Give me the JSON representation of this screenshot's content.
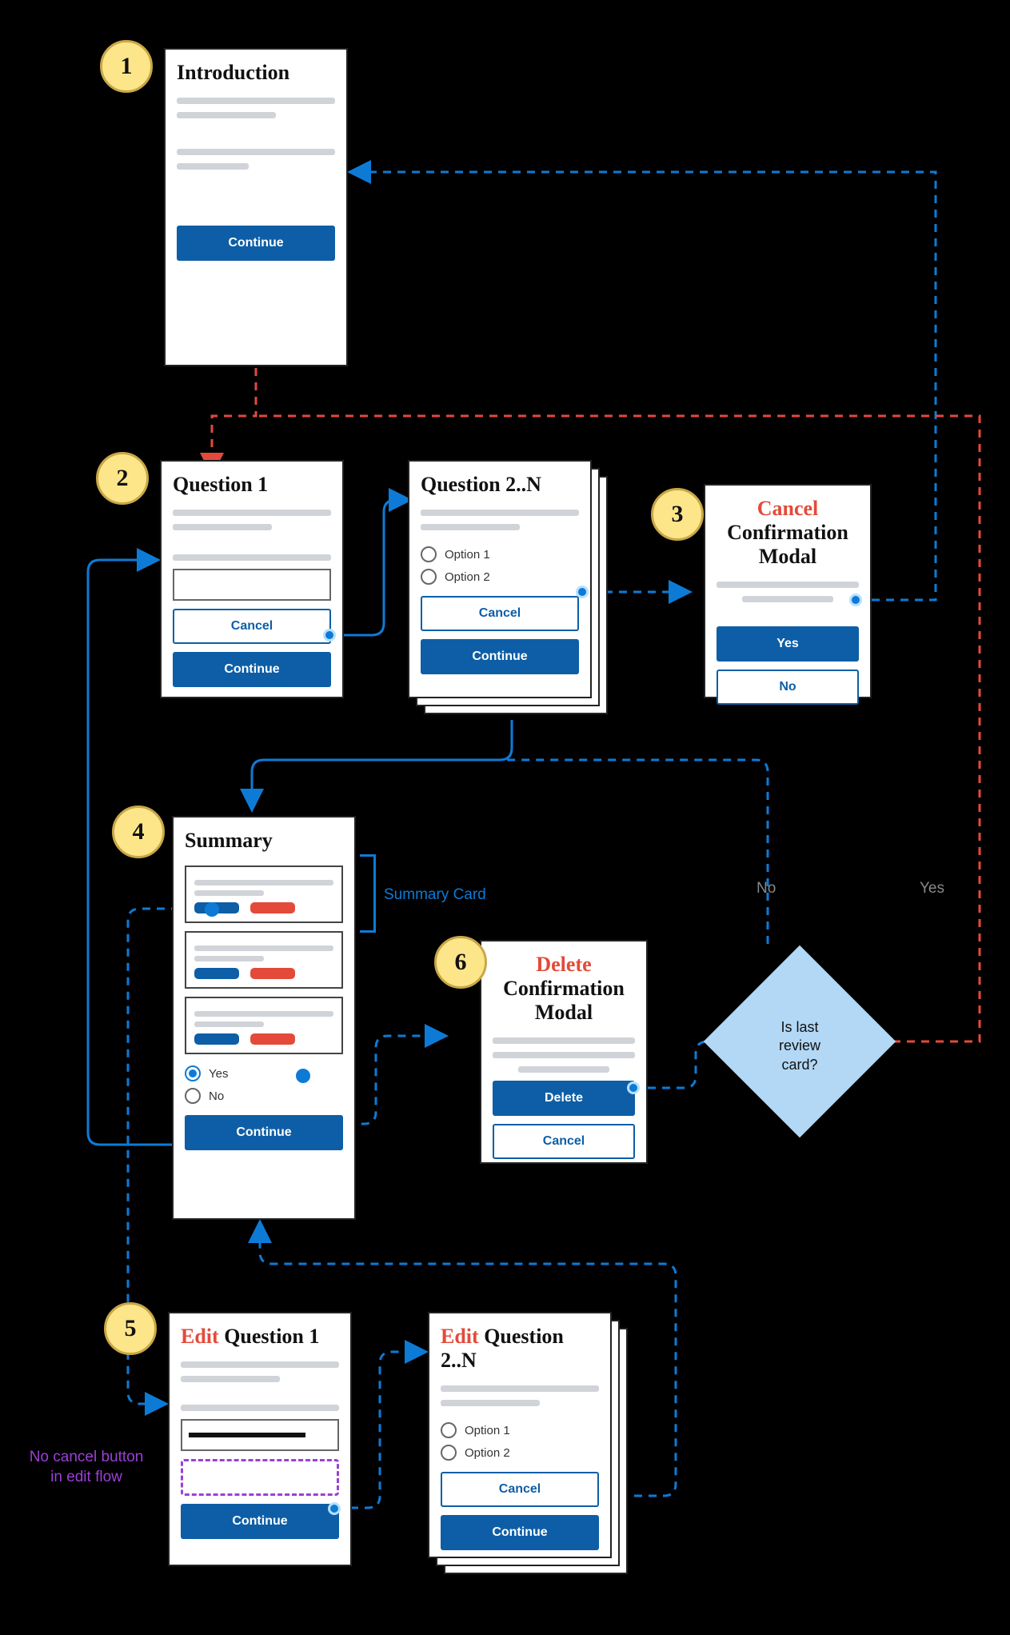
{
  "badges": {
    "b1": "1",
    "b2": "2",
    "b3": "3",
    "b4": "4",
    "b5": "5",
    "b6": "6"
  },
  "intro": {
    "title": "Introduction",
    "continue": "Continue"
  },
  "q1": {
    "title": "Question 1",
    "cancel": "Cancel",
    "continue": "Continue"
  },
  "qN": {
    "title": "Question 2..N",
    "opt1": "Option 1",
    "opt2": "Option 2",
    "cancel": "Cancel",
    "continue": "Continue"
  },
  "cancelModal": {
    "title_red": "Cancel",
    "title_rest": "Confirmation Modal",
    "yes": "Yes",
    "no": "No"
  },
  "summary": {
    "title": "Summary",
    "yes": "Yes",
    "no": "No",
    "continue": "Continue"
  },
  "summaryCardLabel": "Summary Card",
  "deleteModal": {
    "title_red": "Delete",
    "title_rest": "Confirmation Modal",
    "delete": "Delete",
    "cancel": "Cancel"
  },
  "diamond": {
    "l1": "Is last",
    "l2": "review",
    "l3": "card?"
  },
  "diamondNo": "No",
  "diamondYes": "Yes",
  "editQ1": {
    "title_red": "Edit",
    "title_rest": " Question 1",
    "continue": "Continue"
  },
  "editQN": {
    "title_red": "Edit",
    "title_rest": " Question 2..N",
    "opt1": "Option 1",
    "opt2": "Option 2",
    "cancel": "Cancel",
    "continue": "Continue"
  },
  "noCancelNote": {
    "l1": "No cancel button",
    "l2": "in edit flow"
  }
}
